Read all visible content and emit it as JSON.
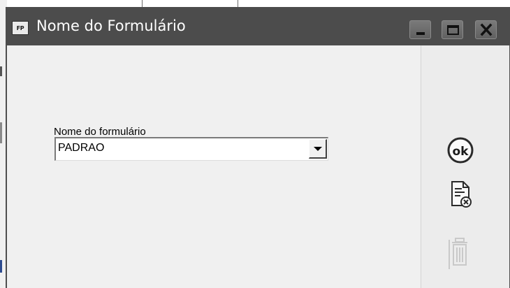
{
  "window": {
    "app_icon_text": "FP",
    "title": "Nome do Formulário"
  },
  "form": {
    "label": "Nome do formulário",
    "selected_value": "PADRAO"
  },
  "icons": {
    "minimize": "minimize-icon",
    "maximize": "maximize-icon",
    "close": "close-icon",
    "ok": "ok-icon",
    "cancel": "document-cancel-icon",
    "delete": "trash-icon"
  }
}
